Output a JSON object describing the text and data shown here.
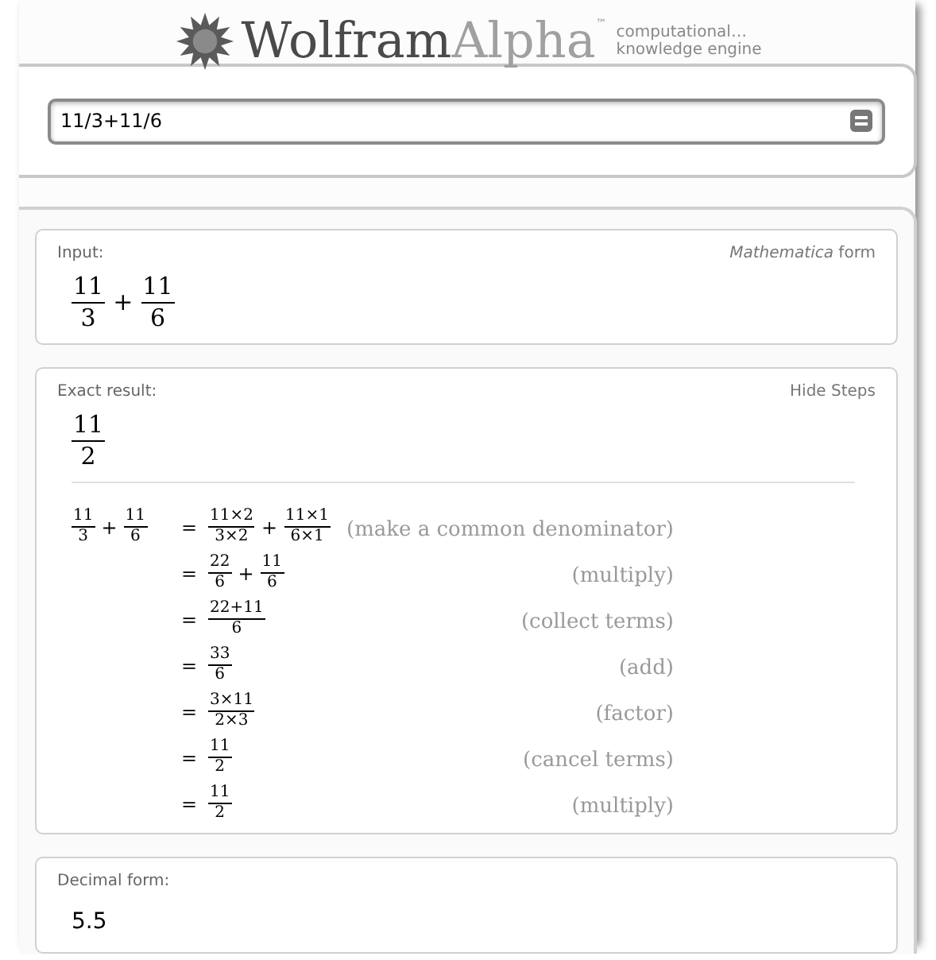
{
  "logo": {
    "brand_dark": "Wolfram",
    "brand_light": "Alpha",
    "trademark": "™",
    "tagline": [
      "computational…",
      "knowledge engine"
    ]
  },
  "search": {
    "value": "11/3+11/6"
  },
  "pods": [
    {
      "kind": "expression",
      "title": "Input:",
      "action": "*Mathematica* form",
      "expression": [
        {
          "kind": "fraction",
          "num": "11",
          "den": "3"
        },
        {
          "kind": "operator",
          "text": "+"
        },
        {
          "kind": "fraction",
          "num": "11",
          "den": "6"
        }
      ]
    },
    {
      "kind": "steps",
      "title": "Exact result:",
      "action": "Hide Steps",
      "expression": [
        {
          "kind": "fraction",
          "num": "11",
          "den": "2"
        }
      ],
      "steps": [
        {
          "lhs": [
            {
              "kind": "fraction",
              "num": "11",
              "den": "3"
            },
            {
              "kind": "operator",
              "text": "+"
            },
            {
              "kind": "fraction",
              "num": "11",
              "den": "6"
            }
          ],
          "eq": "=",
          "rhs": [
            {
              "kind": "fraction",
              "num": "11×2",
              "den": "3×2"
            },
            {
              "kind": "operator",
              "text": "+"
            },
            {
              "kind": "fraction",
              "num": "11×1",
              "den": "6×1"
            }
          ],
          "reason": "(make a common denominator)"
        },
        {
          "eq": "=",
          "rhs": [
            {
              "kind": "fraction",
              "num": "22",
              "den": "6"
            },
            {
              "kind": "operator",
              "text": "+"
            },
            {
              "kind": "fraction",
              "num": "11",
              "den": "6"
            }
          ],
          "reason": "(multiply)"
        },
        {
          "eq": "=",
          "rhs": [
            {
              "kind": "fraction",
              "num": "22+11",
              "den": "6"
            }
          ],
          "reason": "(collect terms)"
        },
        {
          "eq": "=",
          "rhs": [
            {
              "kind": "fraction",
              "num": "33",
              "den": "6"
            }
          ],
          "reason": "(add)"
        },
        {
          "eq": "=",
          "rhs": [
            {
              "kind": "fraction",
              "num": "3×11",
              "den": "2×3"
            }
          ],
          "reason": "(factor)"
        },
        {
          "eq": "=",
          "rhs": [
            {
              "kind": "fraction",
              "num": "11",
              "den": "2"
            }
          ],
          "reason": "(cancel terms)"
        },
        {
          "eq": "=",
          "rhs": [
            {
              "kind": "fraction",
              "num": "11",
              "den": "2"
            }
          ],
          "reason": "(multiply)"
        }
      ]
    },
    {
      "kind": "text",
      "title": "Decimal form:",
      "value": "5.5"
    }
  ]
}
